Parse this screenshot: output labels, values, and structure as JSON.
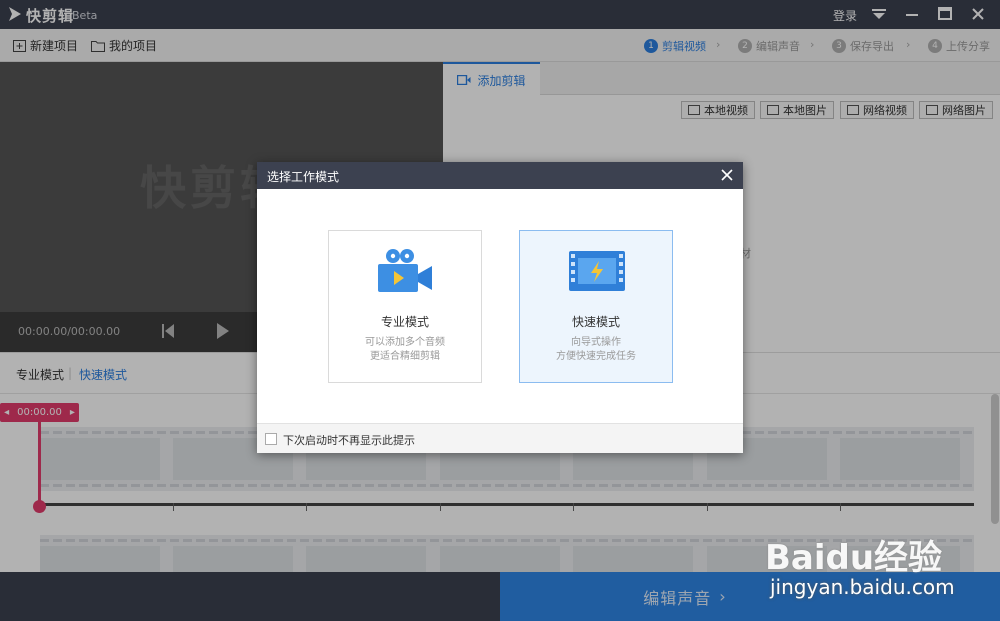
{
  "titlebar": {
    "app_name": "快剪辑",
    "badge": "Beta",
    "login": "登录",
    "logo_icon": "play-logo-icon",
    "menu_icon": "dropdown-menu-icon",
    "min_icon": "minimize-icon",
    "max_icon": "maximize-icon",
    "close_icon": "close-icon"
  },
  "toolbar": {
    "new_project": "新建项目",
    "my_projects": "我的项目"
  },
  "steps": [
    {
      "num": "1",
      "label": "剪辑视频"
    },
    {
      "num": "2",
      "label": "编辑声音"
    },
    {
      "num": "3",
      "label": "保存导出"
    },
    {
      "num": "4",
      "label": "上传分享"
    }
  ],
  "preview": {
    "watermark": "快剪辑",
    "timecode": "00:00.00/00:00.00"
  },
  "panel": {
    "tab": "添加剪辑",
    "sources": [
      "本地视频",
      "本地图片",
      "网络视频",
      "网络图片"
    ],
    "hint_fragment": "材"
  },
  "modes": {
    "pro": "专业模式",
    "separator": "|",
    "quick": "快速模式"
  },
  "timeline": {
    "playhead": "00:00.00"
  },
  "bottom": {
    "next_label": "编辑声音",
    "next_arrow": "›"
  },
  "watermark_site": {
    "logo": "Baidu经验",
    "url": "jingyan.baidu.com"
  },
  "dialog": {
    "title": "选择工作模式",
    "cards": [
      {
        "title": "专业模式",
        "line1": "可以添加多个音频",
        "line2": "更适合精细剪辑",
        "icon": "film-camera-icon"
      },
      {
        "title": "快速模式",
        "line1": "向导式操作",
        "line2": "方便快速完成任务",
        "icon": "film-strip-flash-icon"
      }
    ],
    "checkbox_label": "下次启动时不再显示此提示"
  },
  "colors": {
    "accent": "#2b7fe0",
    "titlebar": "#3c4150",
    "playhead": "#e23c6c",
    "next_button": "#2f86e6"
  }
}
